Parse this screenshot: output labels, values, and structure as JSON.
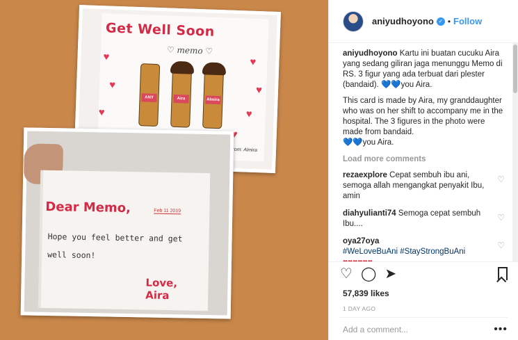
{
  "post": {
    "username": "aniyudhoyono",
    "verified_mark": "✓",
    "follow_label": "Follow",
    "caption_username": "aniyudhoyono",
    "caption_text": "Kartu ini buatan cucuku Aira yang sedang giliran jaga menunggu Memo di RS. 3 figur yang ada terbuat dari plester (bandaid).",
    "caption_hearts": "💙💙",
    "caption_suffix": "you Aira.",
    "translation_text": "This card is made by Aira, my granddaughter who was on her shift to accompany me in the hospital. The 3 figures in the photo were made from bandaid.",
    "translation_hearts": "💙💙",
    "translation_suffix": "you Aira.",
    "load_more": "Load more comments",
    "comments": [
      {
        "username": "rezaexplore",
        "text": "Cepat sembuh ibu ani, semoga allah mengangkat penyakit Ibu, amin"
      },
      {
        "username": "diahyulianti74",
        "text": "Semoga cepat sembuh Ibu...."
      },
      {
        "username": "oya27oya",
        "tags": "#WeLoveBuAni #StayStrongBuAni",
        "hearts": "♥♥♥♥♥♥"
      }
    ],
    "likes": "57,839 likes",
    "time": "1 DAY AGO",
    "add_comment_placeholder": "Add a comment...",
    "more_options": "•••"
  },
  "image": {
    "card_title": "Get Well Soon",
    "card_memo": "♡ memo ♡",
    "figure_tags": [
      "ANY",
      "Aira",
      "Almira"
    ],
    "from_note": "From: Almira",
    "letter_greeting": "Dear Memo,",
    "letter_date": "Feb 11 2019",
    "letter_body": "Hope you feel better and get well soon!",
    "letter_signoff": "Love,",
    "letter_name": "Aira"
  },
  "icons": {
    "like": "heart-outline-icon",
    "comment": "speech-bubble-icon",
    "share": "share-arrow-icon",
    "save": "bookmark-icon",
    "verified": "verified-badge-icon"
  },
  "colors": {
    "background": "#c9874a",
    "link": "#3897f0",
    "card_red": "#d22b46"
  }
}
